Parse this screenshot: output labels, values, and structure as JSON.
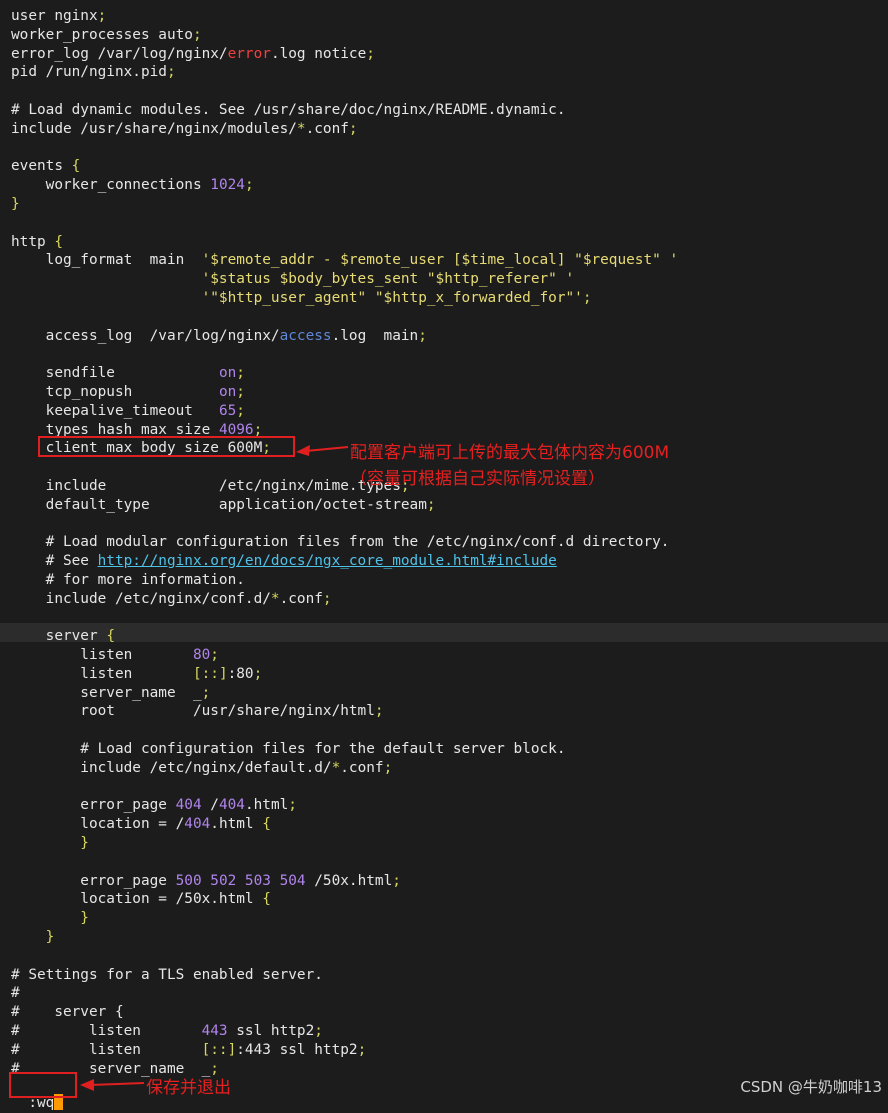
{
  "lines": [
    {
      "segs": [
        [
          "user nginx",
          ""
        ],
        [
          ";",
          "c-semi"
        ]
      ]
    },
    {
      "segs": [
        [
          "worker_processes auto",
          ""
        ],
        [
          ";",
          "c-semi"
        ]
      ]
    },
    {
      "segs": [
        [
          "error_log /var/log/nginx/",
          ""
        ],
        [
          "error",
          "c-red"
        ],
        [
          ".log notice",
          ""
        ],
        [
          ";",
          "c-semi"
        ]
      ]
    },
    {
      "segs": [
        [
          "pid /run/nginx.pid",
          ""
        ],
        [
          ";",
          "c-semi"
        ]
      ]
    },
    {
      "segs": []
    },
    {
      "segs": [
        [
          "# Load dynamic modules. See /usr/share/doc/nginx/README.dynamic.",
          "c-comment"
        ]
      ]
    },
    {
      "segs": [
        [
          "include /usr/share/nginx/modules/",
          ""
        ],
        [
          "*",
          "c-semi"
        ],
        [
          ".conf",
          ""
        ],
        [
          ";",
          "c-semi"
        ]
      ]
    },
    {
      "segs": []
    },
    {
      "segs": [
        [
          "events ",
          ""
        ],
        [
          "{",
          "c-brace"
        ]
      ]
    },
    {
      "segs": [
        [
          "    worker_connections ",
          ""
        ],
        [
          "1024",
          "c-num"
        ],
        [
          ";",
          "c-semi"
        ]
      ]
    },
    {
      "segs": [
        [
          "}",
          "c-brace"
        ]
      ]
    },
    {
      "segs": []
    },
    {
      "segs": [
        [
          "http ",
          ""
        ],
        [
          "{",
          "c-brace"
        ]
      ]
    },
    {
      "segs": [
        [
          "    log_format  main  ",
          ""
        ],
        [
          "'$remote_addr - $remote_user [$time_local] \"$request\" '",
          "c-str"
        ]
      ]
    },
    {
      "segs": [
        [
          "                      ",
          ""
        ],
        [
          "'$status $body_bytes_sent \"$http_referer\" '",
          "c-str"
        ]
      ]
    },
    {
      "segs": [
        [
          "                      ",
          ""
        ],
        [
          "'\"$http_user_agent\" \"$http_x_forwarded_for\"'",
          "c-str"
        ],
        [
          ";",
          "c-semi"
        ]
      ]
    },
    {
      "segs": []
    },
    {
      "segs": [
        [
          "    access_log  /var/log/nginx/",
          ""
        ],
        [
          "access",
          "c-blue"
        ],
        [
          ".log  main",
          ""
        ],
        [
          ";",
          "c-semi"
        ]
      ]
    },
    {
      "segs": []
    },
    {
      "segs": [
        [
          "    sendfile            ",
          ""
        ],
        [
          "on",
          "c-num"
        ],
        [
          ";",
          "c-semi"
        ]
      ]
    },
    {
      "segs": [
        [
          "    tcp_nopush          ",
          ""
        ],
        [
          "on",
          "c-num"
        ],
        [
          ";",
          "c-semi"
        ]
      ]
    },
    {
      "segs": [
        [
          "    keepalive_timeout   ",
          ""
        ],
        [
          "65",
          "c-num"
        ],
        [
          ";",
          "c-semi"
        ]
      ]
    },
    {
      "segs": [
        [
          "    types_hash_max_size ",
          ""
        ],
        [
          "4096",
          "c-num"
        ],
        [
          ";",
          "c-semi"
        ]
      ]
    },
    {
      "segs": [
        [
          "    client_max_body_size 600M",
          ""
        ],
        [
          ";",
          "c-semi"
        ]
      ]
    },
    {
      "segs": []
    },
    {
      "segs": [
        [
          "    include             /etc/nginx/mime.types",
          ""
        ],
        [
          ";",
          "c-semi"
        ]
      ]
    },
    {
      "segs": [
        [
          "    default_type        application/octet-stream",
          ""
        ],
        [
          ";",
          "c-semi"
        ]
      ]
    },
    {
      "segs": []
    },
    {
      "segs": [
        [
          "    # Load modular configuration files from the /etc/nginx/conf.d directory.",
          "c-comment"
        ]
      ]
    },
    {
      "segs": [
        [
          "    # See ",
          "c-comment"
        ],
        [
          "http://nginx.org/en/docs/ngx_core_module.html#include",
          "c-url"
        ]
      ]
    },
    {
      "segs": [
        [
          "    # for more information.",
          "c-comment"
        ]
      ]
    },
    {
      "segs": [
        [
          "    include /etc/nginx/conf.d/",
          ""
        ],
        [
          "*",
          "c-semi"
        ],
        [
          ".conf",
          ""
        ],
        [
          ";",
          "c-semi"
        ]
      ]
    },
    {
      "segs": []
    },
    {
      "segs": [
        [
          "    server ",
          ""
        ],
        [
          "{",
          "c-brace"
        ]
      ]
    },
    {
      "segs": [
        [
          "        listen       ",
          ""
        ],
        [
          "80",
          "c-num"
        ],
        [
          ";",
          "c-semi"
        ]
      ]
    },
    {
      "segs": [
        [
          "        listen       ",
          ""
        ],
        [
          "[::]",
          "c-semi"
        ],
        [
          ":80",
          ""
        ],
        [
          ";",
          "c-semi"
        ]
      ]
    },
    {
      "segs": [
        [
          "        server_name  _",
          ""
        ],
        [
          ";",
          "c-semi"
        ]
      ]
    },
    {
      "segs": [
        [
          "        root         /usr/share/nginx/html",
          ""
        ],
        [
          ";",
          "c-semi"
        ]
      ]
    },
    {
      "segs": []
    },
    {
      "segs": [
        [
          "        # Load configuration files for the default server block.",
          "c-comment"
        ]
      ]
    },
    {
      "segs": [
        [
          "        include /etc/nginx/default.d/",
          ""
        ],
        [
          "*",
          "c-semi"
        ],
        [
          ".conf",
          ""
        ],
        [
          ";",
          "c-semi"
        ]
      ]
    },
    {
      "segs": []
    },
    {
      "segs": [
        [
          "        error_page ",
          ""
        ],
        [
          "404",
          "c-num"
        ],
        [
          " /",
          ""
        ],
        [
          "404",
          "c-num"
        ],
        [
          ".html",
          ""
        ],
        [
          ";",
          "c-semi"
        ]
      ]
    },
    {
      "segs": [
        [
          "        location = /",
          ""
        ],
        [
          "404",
          "c-num"
        ],
        [
          ".html ",
          ""
        ],
        [
          "{",
          "c-brace"
        ]
      ]
    },
    {
      "segs": [
        [
          "        }",
          "c-brace"
        ]
      ]
    },
    {
      "segs": []
    },
    {
      "segs": [
        [
          "        error_page ",
          ""
        ],
        [
          "500 502 503 504",
          "c-num"
        ],
        [
          " /50x.html",
          ""
        ],
        [
          ";",
          "c-semi"
        ]
      ]
    },
    {
      "segs": [
        [
          "        location = /50x.html ",
          ""
        ],
        [
          "{",
          "c-brace"
        ]
      ]
    },
    {
      "segs": [
        [
          "        }",
          "c-brace"
        ]
      ]
    },
    {
      "segs": [
        [
          "    }",
          "c-brace"
        ]
      ]
    },
    {
      "segs": []
    },
    {
      "segs": [
        [
          "# Settings for a TLS enabled server.",
          "c-comment"
        ]
      ]
    },
    {
      "segs": [
        [
          "#",
          "c-comment"
        ]
      ]
    },
    {
      "segs": [
        [
          "#    server {",
          "c-comment"
        ]
      ]
    },
    {
      "segs": [
        [
          "#        listen       ",
          "c-comment"
        ],
        [
          "443",
          "c-num"
        ],
        [
          " ssl http2",
          ""
        ],
        [
          ";",
          "c-semi"
        ]
      ]
    },
    {
      "segs": [
        [
          "#        listen       ",
          "c-comment"
        ],
        [
          "[::]",
          "c-semi"
        ],
        [
          ":443 ssl http2",
          ""
        ],
        [
          ";",
          "c-semi"
        ]
      ]
    },
    {
      "segs": [
        [
          "#        server_name  _",
          "c-comment"
        ],
        [
          ";",
          "c-semi"
        ]
      ]
    }
  ],
  "status": {
    "command": ":wq"
  },
  "annotations": {
    "main_line1": "配置客户端可上传的最大包体内容为600M",
    "main_line2": "（容量可根据自己实际情况设置）",
    "save_note": "保存并退出"
  },
  "watermark": "CSDN @牛奶咖啡13",
  "colors": {
    "background": "#1c1c1c",
    "annotation": "#e02020",
    "cursor": "#ff9a00"
  }
}
